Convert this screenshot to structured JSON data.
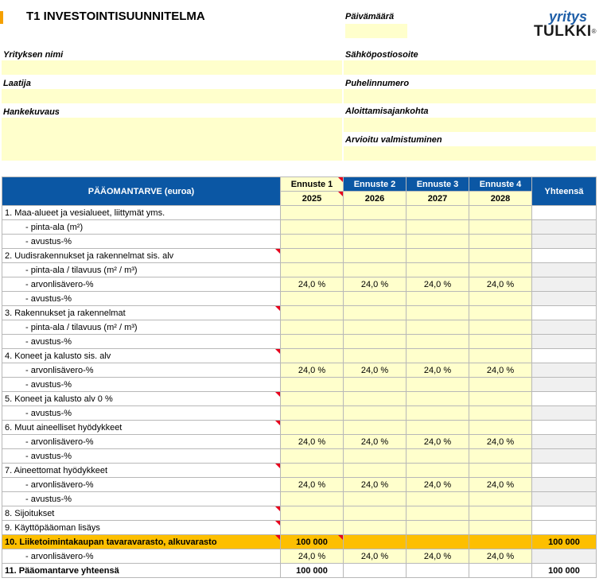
{
  "header": {
    "title": "T1  INVESTOINTISUUNNITELMA",
    "date_label": "Päivämäärä",
    "company_label": "Yrityksen nimi",
    "email_label": "Sähköpostiosoite",
    "preparer_label": "Laatija",
    "phone_label": "Puhelinnumero",
    "project_label": "Hankekuvaus",
    "start_label": "Aloittamisajankohta",
    "completion_label": "Arvioitu valmistuminen"
  },
  "logo": {
    "top": "yritys",
    "bottom": "TULKKI",
    "reg": "®"
  },
  "table": {
    "title": "PÄÄOMANTARVE (euroa)",
    "columns": [
      {
        "label": "Ennuste 1",
        "year": "2025"
      },
      {
        "label": "Ennuste 2",
        "year": "2026"
      },
      {
        "label": "Ennuste 3",
        "year": "2027"
      },
      {
        "label": "Ennuste 4",
        "year": "2028"
      }
    ],
    "total_label": "Yhteensä",
    "rows": [
      {
        "label": "1.   Maa-alueet ja vesialueet, liittymät yms."
      },
      {
        "label": "- pinta-ala (m²)"
      },
      {
        "label": "- avustus-%"
      },
      {
        "label": "2.   Uudisrakennukset ja rakennelmat sis. alv"
      },
      {
        "label": "- pinta-ala / tilavuus (m² / m³)"
      },
      {
        "label": "- arvonlisävero-%",
        "vals": [
          "24,0 %",
          "24,0 %",
          "24,0 %",
          "24,0 %"
        ]
      },
      {
        "label": "- avustus-%"
      },
      {
        "label": "3.    Rakennukset ja rakennelmat"
      },
      {
        "label": "- pinta-ala / tilavuus (m² / m³)"
      },
      {
        "label": "- avustus-%"
      },
      {
        "label": "4.   Koneet ja kalusto sis. alv"
      },
      {
        "label": "- arvonlisävero-%",
        "vals": [
          "24,0 %",
          "24,0 %",
          "24,0 %",
          "24,0 %"
        ]
      },
      {
        "label": "- avustus-%"
      },
      {
        "label": "5.   Koneet ja kalusto alv 0 %"
      },
      {
        "label": "- avustus-%"
      },
      {
        "label": "6.   Muut aineelliset hyödykkeet"
      },
      {
        "label": "- arvonlisävero-%",
        "vals": [
          "24,0 %",
          "24,0 %",
          "24,0 %",
          "24,0 %"
        ]
      },
      {
        "label": "- avustus-%"
      },
      {
        "label": "7.   Aineettomat hyödykkeet"
      },
      {
        "label": "- arvonlisävero-%",
        "vals": [
          "24,0 %",
          "24,0 %",
          "24,0 %",
          "24,0 %"
        ]
      },
      {
        "label": "- avustus-%"
      },
      {
        "label": "8.   Sijoitukset"
      },
      {
        "label": "9.   Käyttöpääoman lisäys"
      },
      {
        "label": "10.  Liiketoimintakaupan tavaravarasto, alkuvarasto",
        "vals": [
          "100 000",
          "",
          "",
          ""
        ],
        "total": "100 000"
      },
      {
        "label": "- arvonlisävero-%",
        "vals": [
          "24,0 %",
          "24,0 %",
          "24,0 %",
          "24,0 %"
        ]
      },
      {
        "label": "11.  Pääomantarve yhteensä",
        "vals": [
          "100 000",
          "",
          "",
          ""
        ],
        "total": "100 000"
      }
    ]
  }
}
